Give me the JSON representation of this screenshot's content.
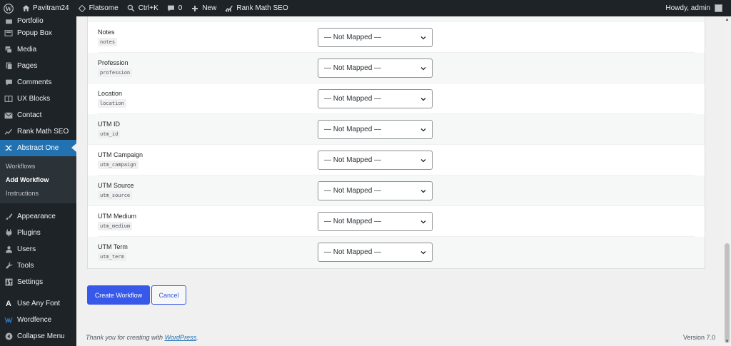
{
  "admin_bar": {
    "site_name": "Pavitram24",
    "theme": "Flatsome",
    "shortcut": "Ctrl+K",
    "comments_count": "0",
    "new_label": "New",
    "seo_label": "Rank Math SEO",
    "greeting": "Howdy, admin"
  },
  "sidebar": {
    "portfolio": "Portfolio",
    "items_top": [
      {
        "label": "Popup Box",
        "icon": "popup-icon"
      },
      {
        "label": "Media",
        "icon": "media-icon"
      },
      {
        "label": "Pages",
        "icon": "pages-icon"
      },
      {
        "label": "Comments",
        "icon": "comments-icon"
      },
      {
        "label": "UX Blocks",
        "icon": "ux-blocks-icon"
      },
      {
        "label": "Contact",
        "icon": "mail-icon"
      },
      {
        "label": "Rank Math SEO",
        "icon": "rank-math-icon"
      }
    ],
    "active": "Abstract One",
    "submenu": [
      "Workflows",
      "Add Workflow",
      "Instructions"
    ],
    "items_bottom": [
      {
        "label": "Appearance"
      },
      {
        "label": "Plugins"
      },
      {
        "label": "Users"
      },
      {
        "label": "Tools"
      },
      {
        "label": "Settings"
      }
    ],
    "items_extra": [
      {
        "label": "Use Any Font"
      },
      {
        "label": "Wordfence"
      },
      {
        "label": "Collapse Menu"
      }
    ]
  },
  "mapping_rows": [
    {
      "label": "Notes",
      "key": "notes",
      "value": "— Not Mapped —"
    },
    {
      "label": "Profession",
      "key": "profession",
      "value": "— Not Mapped —"
    },
    {
      "label": "Location",
      "key": "location",
      "value": "— Not Mapped —"
    },
    {
      "label": "UTM ID",
      "key": "utm_id",
      "value": "— Not Mapped —"
    },
    {
      "label": "UTM Campaign",
      "key": "utm_campaign",
      "value": "— Not Mapped —"
    },
    {
      "label": "UTM Source",
      "key": "utm_source",
      "value": "— Not Mapped —"
    },
    {
      "label": "UTM Medium",
      "key": "utm_medium",
      "value": "— Not Mapped —"
    },
    {
      "label": "UTM Term",
      "key": "utm_term",
      "value": "— Not Mapped —"
    }
  ],
  "actions": {
    "create": "Create Workflow",
    "cancel": "Cancel"
  },
  "footer": {
    "thanks": "Thank you for creating with ",
    "wp_link": "WordPress",
    "period": ".",
    "version": "Version 7.0"
  },
  "colors": {
    "admin_dark": "#1d2327",
    "active_menu": "#2271b1",
    "primary_button": "#3858e9"
  }
}
